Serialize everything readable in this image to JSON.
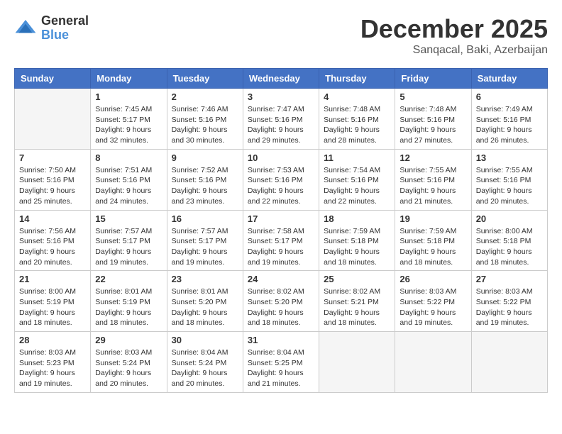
{
  "logo": {
    "general": "General",
    "blue": "Blue"
  },
  "header": {
    "month": "December 2025",
    "location": "Sanqacal, Baki, Azerbaijan"
  },
  "days_of_week": [
    "Sunday",
    "Monday",
    "Tuesday",
    "Wednesday",
    "Thursday",
    "Friday",
    "Saturday"
  ],
  "weeks": [
    [
      {
        "day": "",
        "empty": true
      },
      {
        "day": "1",
        "sunrise": "7:45 AM",
        "sunset": "5:17 PM",
        "daylight": "9 hours and 32 minutes."
      },
      {
        "day": "2",
        "sunrise": "7:46 AM",
        "sunset": "5:16 PM",
        "daylight": "9 hours and 30 minutes."
      },
      {
        "day": "3",
        "sunrise": "7:47 AM",
        "sunset": "5:16 PM",
        "daylight": "9 hours and 29 minutes."
      },
      {
        "day": "4",
        "sunrise": "7:48 AM",
        "sunset": "5:16 PM",
        "daylight": "9 hours and 28 minutes."
      },
      {
        "day": "5",
        "sunrise": "7:48 AM",
        "sunset": "5:16 PM",
        "daylight": "9 hours and 27 minutes."
      },
      {
        "day": "6",
        "sunrise": "7:49 AM",
        "sunset": "5:16 PM",
        "daylight": "9 hours and 26 minutes."
      }
    ],
    [
      {
        "day": "7",
        "sunrise": "7:50 AM",
        "sunset": "5:16 PM",
        "daylight": "9 hours and 25 minutes."
      },
      {
        "day": "8",
        "sunrise": "7:51 AM",
        "sunset": "5:16 PM",
        "daylight": "9 hours and 24 minutes."
      },
      {
        "day": "9",
        "sunrise": "7:52 AM",
        "sunset": "5:16 PM",
        "daylight": "9 hours and 23 minutes."
      },
      {
        "day": "10",
        "sunrise": "7:53 AM",
        "sunset": "5:16 PM",
        "daylight": "9 hours and 22 minutes."
      },
      {
        "day": "11",
        "sunrise": "7:54 AM",
        "sunset": "5:16 PM",
        "daylight": "9 hours and 22 minutes."
      },
      {
        "day": "12",
        "sunrise": "7:55 AM",
        "sunset": "5:16 PM",
        "daylight": "9 hours and 21 minutes."
      },
      {
        "day": "13",
        "sunrise": "7:55 AM",
        "sunset": "5:16 PM",
        "daylight": "9 hours and 20 minutes."
      }
    ],
    [
      {
        "day": "14",
        "sunrise": "7:56 AM",
        "sunset": "5:16 PM",
        "daylight": "9 hours and 20 minutes."
      },
      {
        "day": "15",
        "sunrise": "7:57 AM",
        "sunset": "5:17 PM",
        "daylight": "9 hours and 19 minutes."
      },
      {
        "day": "16",
        "sunrise": "7:57 AM",
        "sunset": "5:17 PM",
        "daylight": "9 hours and 19 minutes."
      },
      {
        "day": "17",
        "sunrise": "7:58 AM",
        "sunset": "5:17 PM",
        "daylight": "9 hours and 19 minutes."
      },
      {
        "day": "18",
        "sunrise": "7:59 AM",
        "sunset": "5:18 PM",
        "daylight": "9 hours and 18 minutes."
      },
      {
        "day": "19",
        "sunrise": "7:59 AM",
        "sunset": "5:18 PM",
        "daylight": "9 hours and 18 minutes."
      },
      {
        "day": "20",
        "sunrise": "8:00 AM",
        "sunset": "5:18 PM",
        "daylight": "9 hours and 18 minutes."
      }
    ],
    [
      {
        "day": "21",
        "sunrise": "8:00 AM",
        "sunset": "5:19 PM",
        "daylight": "9 hours and 18 minutes."
      },
      {
        "day": "22",
        "sunrise": "8:01 AM",
        "sunset": "5:19 PM",
        "daylight": "9 hours and 18 minutes."
      },
      {
        "day": "23",
        "sunrise": "8:01 AM",
        "sunset": "5:20 PM",
        "daylight": "9 hours and 18 minutes."
      },
      {
        "day": "24",
        "sunrise": "8:02 AM",
        "sunset": "5:20 PM",
        "daylight": "9 hours and 18 minutes."
      },
      {
        "day": "25",
        "sunrise": "8:02 AM",
        "sunset": "5:21 PM",
        "daylight": "9 hours and 18 minutes."
      },
      {
        "day": "26",
        "sunrise": "8:03 AM",
        "sunset": "5:22 PM",
        "daylight": "9 hours and 19 minutes."
      },
      {
        "day": "27",
        "sunrise": "8:03 AM",
        "sunset": "5:22 PM",
        "daylight": "9 hours and 19 minutes."
      }
    ],
    [
      {
        "day": "28",
        "sunrise": "8:03 AM",
        "sunset": "5:23 PM",
        "daylight": "9 hours and 19 minutes."
      },
      {
        "day": "29",
        "sunrise": "8:03 AM",
        "sunset": "5:24 PM",
        "daylight": "9 hours and 20 minutes."
      },
      {
        "day": "30",
        "sunrise": "8:04 AM",
        "sunset": "5:24 PM",
        "daylight": "9 hours and 20 minutes."
      },
      {
        "day": "31",
        "sunrise": "8:04 AM",
        "sunset": "5:25 PM",
        "daylight": "9 hours and 21 minutes."
      },
      {
        "day": "",
        "empty": true
      },
      {
        "day": "",
        "empty": true
      },
      {
        "day": "",
        "empty": true
      }
    ]
  ]
}
